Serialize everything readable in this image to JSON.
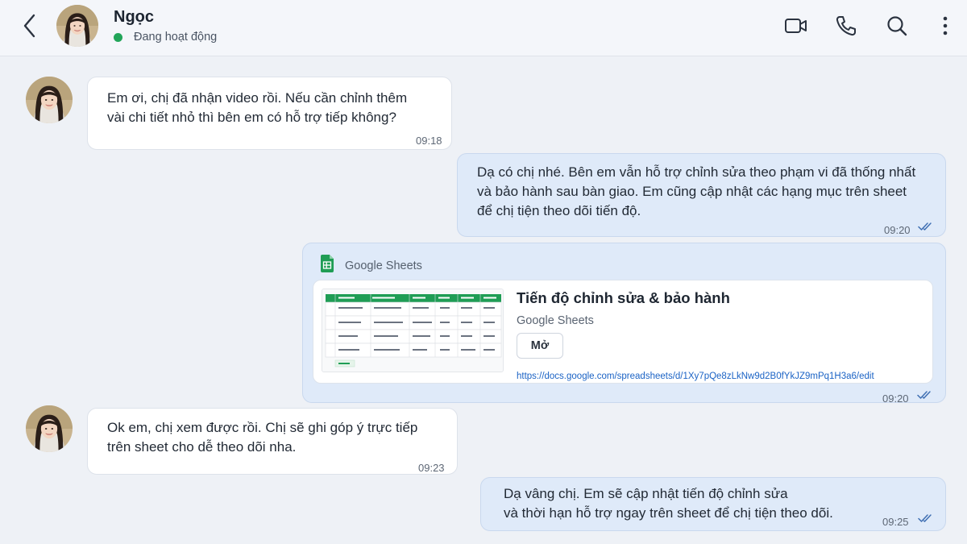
{
  "header": {
    "contact_name": "Ngọc",
    "status": "Đang hoạt động"
  },
  "colors": {
    "status_online": "#22a559",
    "incoming_bubble": "#ffffff",
    "outgoing_bubble": "#dfeaf9",
    "link": "#1b63c5",
    "sheets_green": "#1f9d55"
  },
  "icons": {
    "back": "chevron-left-icon",
    "video": "video-camera-icon",
    "call": "phone-icon",
    "search": "search-icon",
    "more": "more-vertical-icon",
    "read": "double-check-icon"
  },
  "messages": [
    {
      "direction": "in",
      "lines": [
        "Em ơi, chị đã nhận video rồi. Nếu cần chỉnh thêm",
        "vài chi tiết nhỏ thì bên em có hỗ trợ tiếp không?"
      ],
      "time": "09:18"
    },
    {
      "direction": "out",
      "lines": [
        "Dạ có chị nhé. Bên em vẫn hỗ trợ chỉnh sửa theo phạm vi đã thống nhất",
        "và bảo hành sau bàn giao. Em cũng cập nhật các hạng mục trên sheet",
        "để chị tiện theo dõi tiến độ."
      ],
      "time": "09:20",
      "read": true
    },
    {
      "direction": "out",
      "type": "link_card",
      "source": "Google Sheets",
      "card": {
        "title": "Tiến độ chỉnh sửa & bảo hành",
        "subtitle": "Google Sheets",
        "button": "Mở",
        "url": "https://docs.google.com/spreadsheets/d/1Xy7pQe8zLkNw9d2B0fYkJZ9mPq1H3a6/edit"
      },
      "time": "09:20",
      "read": true
    },
    {
      "direction": "in",
      "lines": [
        "Ok em, chị xem được rồi. Chị sẽ ghi góp ý trực tiếp",
        "trên sheet cho dễ theo dõi nha."
      ],
      "time": "09:23"
    },
    {
      "direction": "out",
      "lines": [
        "Dạ vâng chị. Em sẽ cập nhật tiến độ chỉnh sửa",
        "và thời hạn hỗ trợ ngay trên sheet để chị tiện theo dõi."
      ],
      "time": "09:25",
      "read": true
    }
  ]
}
